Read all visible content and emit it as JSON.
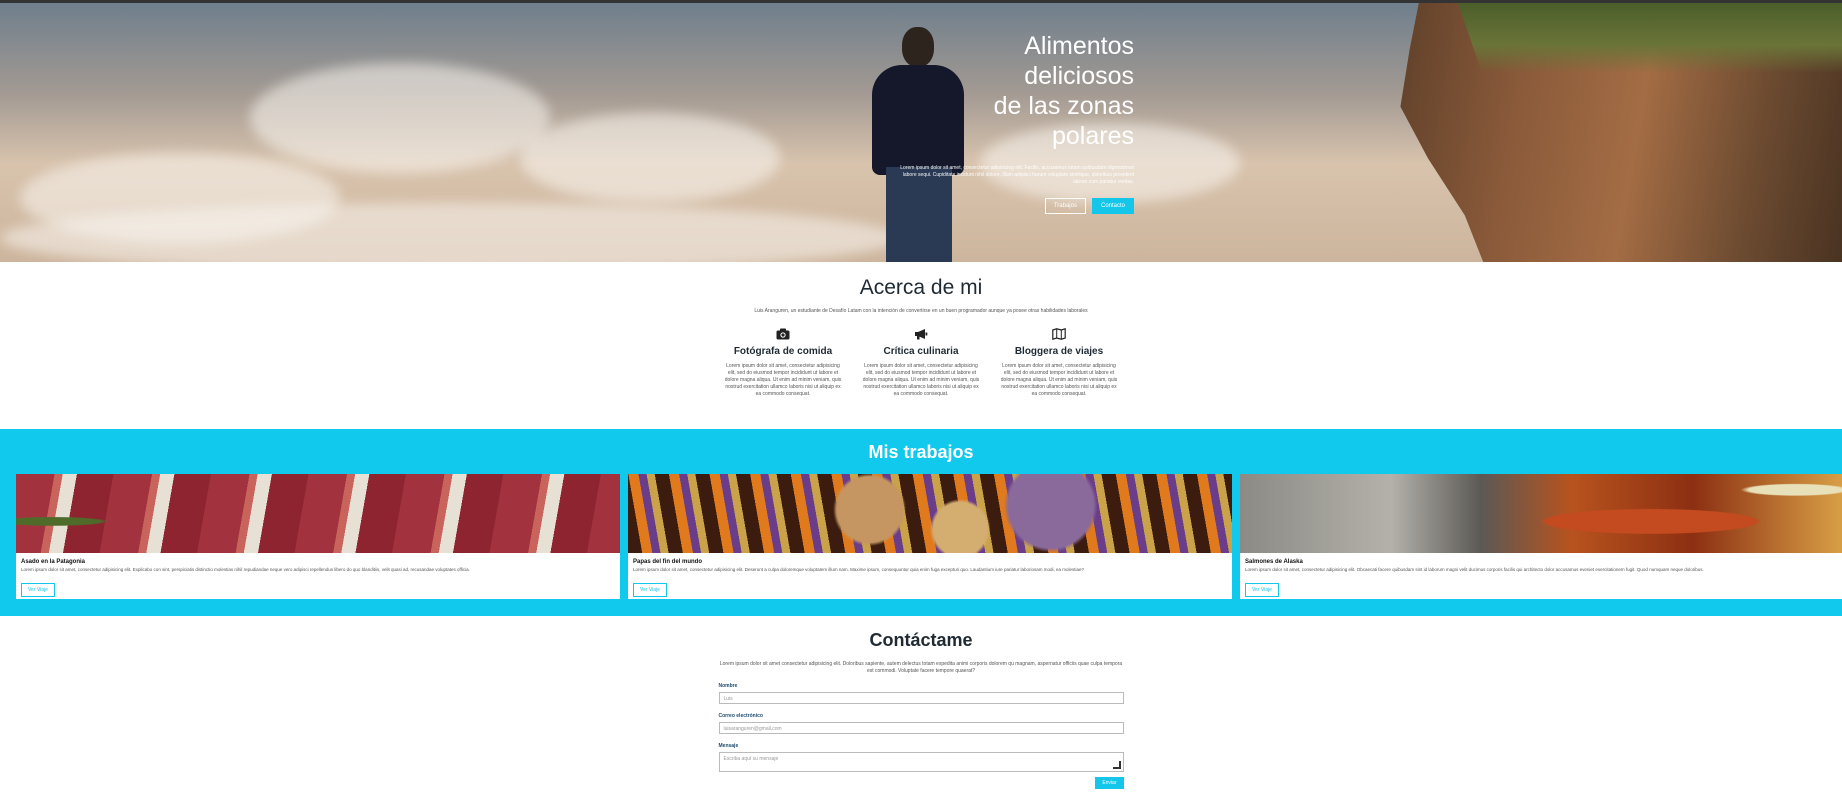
{
  "hero": {
    "title_lines": [
      "Alimentos",
      "deliciosos",
      "de las zonas",
      "polares"
    ],
    "text": "Lorem ipsum dolor sit amet, consectetur adipisicing elit. Facilis, accusamus totam quibusdam dignissimos labore sequi. Cupiditate incidunt nihil dolore. Illum adipisci harum voluptate similique, doloribus provident labore cum pariatur veritas.",
    "btn_works": "Trabajos",
    "btn_contact": "Contacto"
  },
  "about": {
    "title": "Acerca de mi",
    "intro": "Luis Aranguren, un estudiante de Desafío Latam con la intención de convertirse en un buen programador aunque ya posee otras habilidades laborales",
    "features": [
      {
        "icon": "camera-icon",
        "title": "Fotógrafa de comida",
        "text": "Lorem ipsum dolor sit amet, consectetur adipisicing elit, sed do eiusmod tempor incididunt ut labore et dolore magna aliqua. Ut enim ad minim veniam, quis nostrud exercitation ullamco laboris nisi ut aliquip ex ea commodo consequat."
      },
      {
        "icon": "megaphone-icon",
        "title": "Crítica culinaria",
        "text": "Lorem ipsum dolor sit amet, consectetur adipisicing elit, sed do eiusmod tempor incididunt ut labore et dolore magna aliqua. Ut enim ad minim veniam, quis nostrud exercitation ullamco laboris nisi ut aliquip ex ea commodo consequat."
      },
      {
        "icon": "map-icon",
        "title": "Bloggera de viajes",
        "text": "Lorem ipsum dolor sit amet, consectetur adipisicing elit, sed do eiusmod tempor incididunt ut labore et dolore magna aliqua. Ut enim ad minim veniam, quis nostrud exercitation ullamco laboris nisi ut aliquip ex ea commodo consequat."
      }
    ]
  },
  "works": {
    "title": "Mis trabajos",
    "items": [
      {
        "title": "Asado en la Patagonia",
        "text": "Lorem ipsum dolor sit amet, consectetur adipisicing elit. Explicabo con sint, perspiciatis distinctio molestias nihil repudiandae neque vero adipisci repellendus libero do quo blanditiis, velit quasi ad, recusandae voluptates officia.",
        "button": "Ver Viaje"
      },
      {
        "title": "Papas del fin del mundo",
        "text": "Lorem ipsum dolor sit amet, consectetur adipisicing elit. Deserunt a culpa doloremque voluptatem illum nam. Maxime ipsum, consequuntur quia enim fuga excepturi quo. Laudantium iure pariatur laboriosam modi, ea molestiae?",
        "button": "Ver Viaje"
      },
      {
        "title": "Salmones de Alaska",
        "text": "Lorem ipsum dolor sit amet, consectetur adipisicing elit. Obcaecati facere quibusdam sint id laborum magni velit ducimus corporis facilis qui architecto dolor accusamus eveniet exercitationem fugit. Quod numquam neque doloribus.",
        "button": "Ver Viaje"
      }
    ]
  },
  "contact": {
    "title": "Contáctame",
    "intro": "Lorem ipsum dolor sit amet consectetur adipisicing elit. Doloribus sapiente, autem delectus totam expedita animi corporis dolorem qu magnam, aspernatur officiis quae culpa tempora est commodi. Voluptate facere tempore quaerat?",
    "name_label": "Nombre",
    "name_value": "Luis",
    "email_label": "Correo electrónico",
    "email_value": "luisaranguren@gmail.com",
    "message_label": "Mensaje",
    "message_placeholder": "Escriba aquí su mensaje",
    "send": "Enviar"
  },
  "colors": {
    "accent": "#13c6ea",
    "works_bg": "#10c9ec"
  }
}
